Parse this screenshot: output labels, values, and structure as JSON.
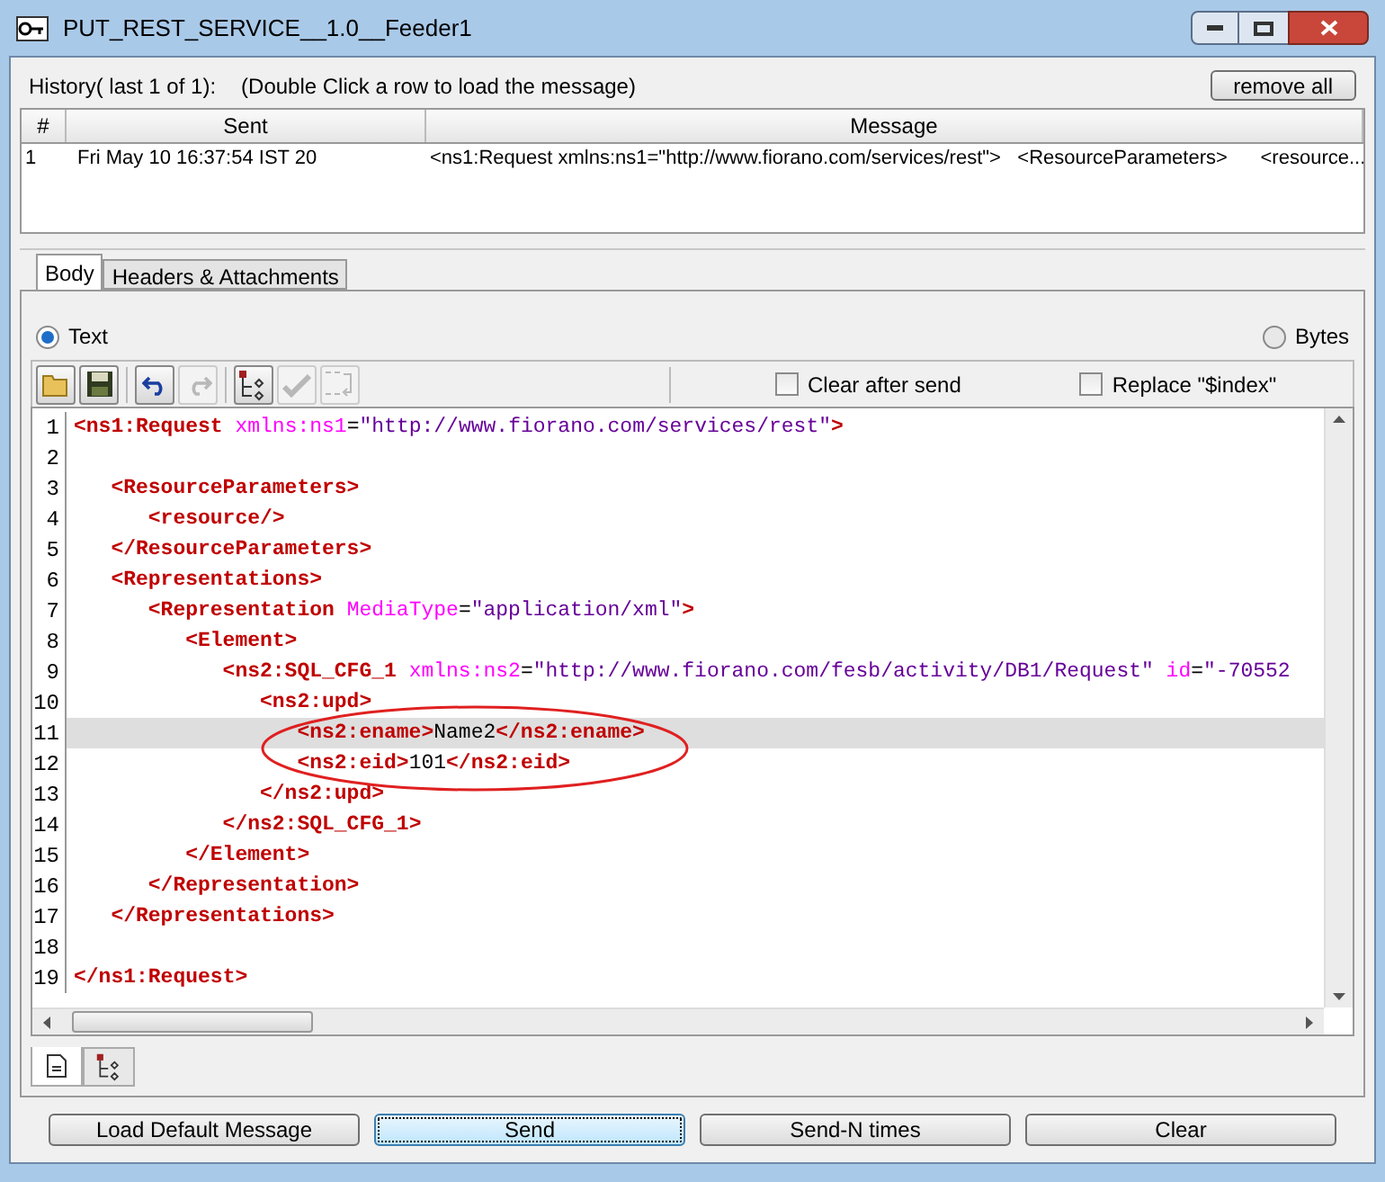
{
  "window": {
    "title": "PUT_REST_SERVICE__1.0__Feeder1"
  },
  "history": {
    "label": "History( last 1 of 1):",
    "hint": "(Double Click a row to load the message)",
    "remove_button": "remove all",
    "columns": [
      "#",
      "Sent",
      "Message"
    ],
    "rows": [
      {
        "cells": [
          "1",
          "Fri May 10 16:37:54 IST 20",
          "<ns1:Request xmlns:ns1=\"http://www.fiorano.com/services/rest\">   <ResourceParameters>      <resource..."
        ]
      }
    ]
  },
  "tabs": [
    {
      "label": "Body",
      "selected": true
    },
    {
      "label": "Headers & Attachments",
      "selected": false
    }
  ],
  "format_options": [
    {
      "label": "Text",
      "selected": true
    },
    {
      "label": "Bytes",
      "selected": false
    }
  ],
  "toolbar": [
    {
      "kind": "open",
      "disabled": false
    },
    {
      "kind": "save",
      "disabled": false
    },
    {
      "kind": "undo",
      "disabled": false
    },
    {
      "kind": "redo",
      "disabled": true
    },
    {
      "kind": "tree",
      "disabled": false
    },
    {
      "kind": "check",
      "disabled": true
    },
    {
      "kind": "xml",
      "disabled": true
    }
  ],
  "toolbar_options": [
    {
      "label": "Clear after send",
      "checked": false
    },
    {
      "label": "Replace \"$index\"",
      "checked": false
    }
  ],
  "editor": {
    "lines": [
      {
        "number": "1",
        "current": false,
        "tokens": [
          {
            "kind": "tag",
            "text": "<ns1:Request"
          },
          {
            "kind": "attr",
            "text": "xmlns:ns1"
          },
          {
            "kind": "plain",
            "text": "="
          },
          {
            "kind": "value",
            "text": "\"http://www.fiorano.com/services/rest\""
          },
          {
            "kind": "tag",
            "text": ">"
          }
        ],
        "children": [
          {
            "number": "2",
            "current": false
          },
          {
            "number": "3",
            "current": false,
            "tokens": [
              {
                "kind": "tag",
                "text": "<ResourceParameters>"
              }
            ],
            "children": [
              {
                "number": "4",
                "current": false,
                "tokens": [
                  {
                    "kind": "tag",
                    "text": "<resource/>"
                  }
                ]
              }
            ]
          },
          {
            "number": "5",
            "current": false,
            "tokens": [
              {
                "kind": "tag",
                "text": "</ResourceParameters>"
              }
            ]
          },
          {
            "number": "6",
            "current": false,
            "tokens": [
              {
                "kind": "tag",
                "text": "<Representations>"
              }
            ],
            "children": [
              {
                "number": "7",
                "current": false,
                "tokens": [
                  {
                    "kind": "tag",
                    "text": "<Representation"
                  },
                  {
                    "kind": "attr",
                    "text": "MediaType"
                  },
                  {
                    "kind": "plain",
                    "text": "="
                  },
                  {
                    "kind": "value",
                    "text": "\"application/xml\""
                  },
                  {
                    "kind": "tag",
                    "text": ">"
                  }
                ],
                "children": [
                  {
                    "number": "8",
                    "current": false,
                    "tokens": [
                      {
                        "kind": "tag",
                        "text": "<Element>"
                      }
                    ],
                    "children": [
                      {
                        "number": "9",
                        "current": false,
                        "tokens": [
                          {
                            "kind": "tag",
                            "text": "<ns2:SQL_CFG_1"
                          },
                          {
                            "kind": "attr",
                            "text": "xmlns:ns2"
                          },
                          {
                            "kind": "plain",
                            "text": "="
                          },
                          {
                            "kind": "value",
                            "text": "\"http://www.fiorano.com/fesb/activity/DB1/Request\""
                          },
                          {
                            "kind": "attr",
                            "text": "id"
                          },
                          {
                            "kind": "plain",
                            "text": "="
                          },
                          {
                            "kind": "value",
                            "text": "\"-70552"
                          }
                        ],
                        "children": [
                          {
                            "number": "10",
                            "current": false,
                            "tokens": [
                              {
                                "kind": "tag",
                                "text": "<ns2:upd>"
                              }
                            ],
                            "children": [
                              {
                                "number": "11",
                                "current": true,
                                "tokens": [
                                  {
                                    "kind": "tag",
                                    "text": "<ns2:ename>"
                                  },
                                  {
                                    "kind": "plain",
                                    "text": "Name2"
                                  },
                                  {
                                    "kind": "tag",
                                    "text": "</ns2:ename>"
                                  }
                                ]
                              },
                              {
                                "number": "12",
                                "current": false,
                                "tokens": [
                                  {
                                    "kind": "tag",
                                    "text": "<ns2:eid>"
                                  },
                                  {
                                    "kind": "plain",
                                    "text": "101"
                                  },
                                  {
                                    "kind": "tag",
                                    "text": "</ns2:eid>"
                                  }
                                ]
                              }
                            ]
                          },
                          {
                            "number": "13",
                            "current": false,
                            "tokens": [
                              {
                                "kind": "tag",
                                "text": "</ns2:upd>"
                              }
                            ]
                          }
                        ]
                      },
                      {
                        "number": "14",
                        "current": false,
                        "tokens": [
                          {
                            "kind": "tag",
                            "text": "</ns2:SQL_CFG_1>"
                          }
                        ]
                      }
                    ]
                  },
                  {
                    "number": "15",
                    "current": false,
                    "tokens": [
                      {
                        "kind": "tag",
                        "text": "</Element>"
                      }
                    ]
                  }
                ]
              },
              {
                "number": "16",
                "current": false,
                "tokens": [
                  {
                    "kind": "tag",
                    "text": "</Representation>"
                  }
                ]
              }
            ]
          },
          {
            "number": "17",
            "current": false,
            "tokens": [
              {
                "kind": "tag",
                "text": "</Representations>"
              }
            ]
          },
          {
            "number": "18",
            "current": false
          }
        ]
      },
      {
        "number": "19",
        "current": false,
        "tokens": [
          {
            "kind": "tag",
            "text": "</ns1:Request>"
          }
        ]
      }
    ]
  },
  "view_tabs": [
    {
      "kind": "text",
      "selected": true
    },
    {
      "kind": "tree",
      "selected": false
    }
  ],
  "buttons": [
    {
      "label": "Load Default Message",
      "focused": false
    },
    {
      "label": "Send",
      "focused": true
    },
    {
      "label": "Send-N times",
      "focused": false
    },
    {
      "label": "Clear",
      "focused": false
    }
  ]
}
